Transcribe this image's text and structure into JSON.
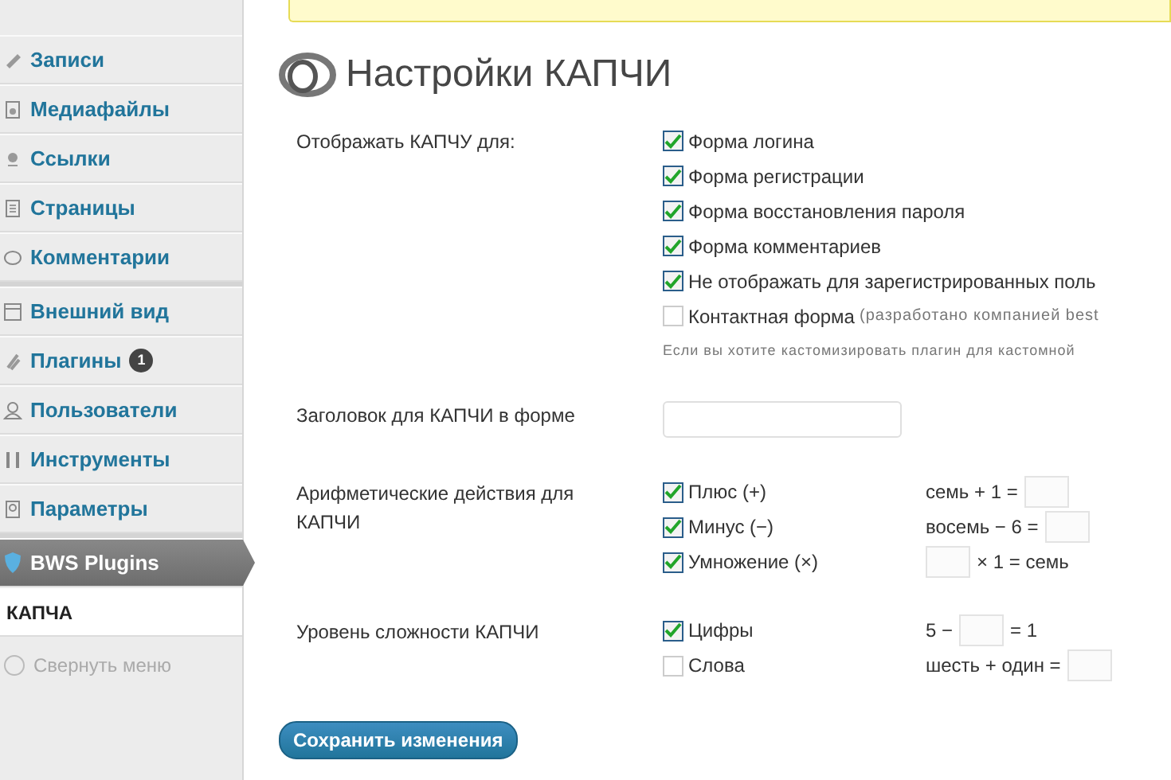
{
  "sidebar": {
    "groups": [
      [
        {
          "label": "Записи",
          "kind": "menu"
        },
        {
          "label": "Медиафайлы",
          "kind": "menu"
        },
        {
          "label": "Ссылки",
          "kind": "menu"
        },
        {
          "label": "Страницы",
          "kind": "menu"
        },
        {
          "label": "Комментарии",
          "kind": "menu"
        }
      ],
      [
        {
          "label": "Внешний вид",
          "kind": "menu"
        },
        {
          "label": "Плагины",
          "kind": "menu",
          "badge": "1"
        },
        {
          "label": "Пользователи",
          "kind": "menu"
        },
        {
          "label": "Инструменты",
          "kind": "menu"
        },
        {
          "label": "Параметры",
          "kind": "menu"
        }
      ],
      [
        {
          "label": "BWS Plugins",
          "kind": "current"
        },
        {
          "label": "КАПЧА",
          "kind": "submenu",
          "selected": true
        },
        {
          "label": "Свернуть меню",
          "kind": "collapse"
        }
      ]
    ]
  },
  "page": {
    "title": "Настройки КАПЧИ",
    "sections": [
      {
        "label": "Отображать КАПЧУ для:",
        "kind": "checklist",
        "options": [
          {
            "label": "Форма логина",
            "checked": true
          },
          {
            "label": "Форма регистрации",
            "checked": true
          },
          {
            "label": "Форма восстановления пароля",
            "checked": true
          },
          {
            "label": "Форма комментариев",
            "checked": true
          },
          {
            "label": "Не отображать для зарегистрированных поль",
            "checked": true
          },
          {
            "label": "Контактная форма",
            "note": "(разработано компанией best",
            "checked": false
          }
        ],
        "help": "Если вы хотите кастомизировать плагин для кастомной"
      },
      {
        "label": "Заголовок для КАПЧИ в форме",
        "kind": "field"
      },
      {
        "label": "Арифметические действия для КАПЧИ",
        "kind": "examples",
        "options": [
          {
            "label": "Плюс (+)",
            "checked": true,
            "before": "семь + 1 ="
          },
          {
            "label": "Минус (−)",
            "checked": true,
            "before": "восемь − 6 ="
          },
          {
            "label": "Умножение (×)",
            "checked": true,
            "after": "× 1 = семь"
          }
        ]
      },
      {
        "label": "Уровень сложности КАПЧИ",
        "kind": "examples",
        "options": [
          {
            "label": "Цифры",
            "checked": true,
            "before": "5 −",
            "after": "= 1"
          },
          {
            "label": "Слова",
            "checked": false,
            "before": "шесть + один ="
          }
        ]
      }
    ],
    "save_button": "Сохранить изменения"
  }
}
